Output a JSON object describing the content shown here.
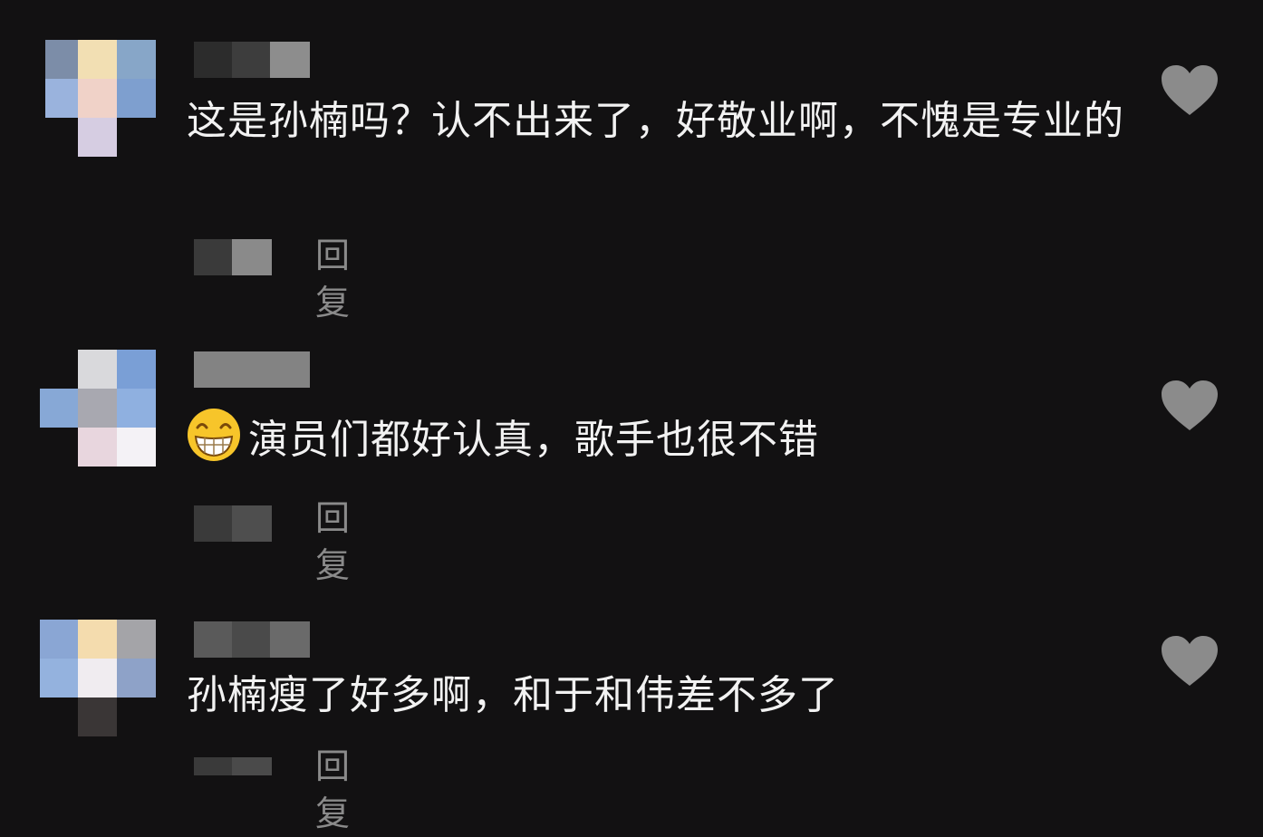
{
  "colors": {
    "background": "#121112",
    "comment_text": "#f2f2f2",
    "reply_text": "#8a8a8a",
    "heart": "#8b8b8b"
  },
  "comments": [
    {
      "text": "这是孙楠吗？认不出来了，好敬业啊，不愧是专业的",
      "has_emoji": false,
      "reply_label": "回复",
      "like_icon": "heart-icon"
    },
    {
      "text": "演员们都好认真，歌手也很不错",
      "has_emoji": true,
      "emoji_icon": "grinning-face-emoji",
      "reply_label": "回复",
      "like_icon": "heart-icon"
    },
    {
      "text": "孙楠瘦了好多啊，和于和伟差不多了",
      "has_emoji": false,
      "reply_label": "回复",
      "like_icon": "heart-icon"
    }
  ]
}
